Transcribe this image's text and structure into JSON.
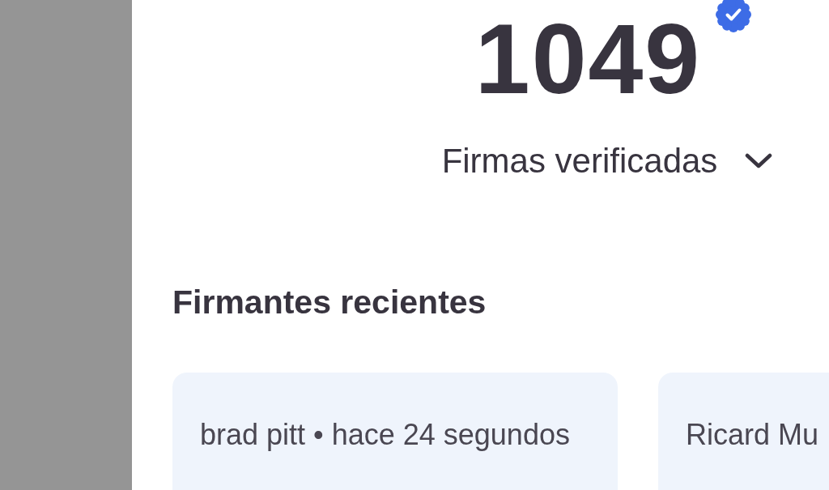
{
  "counter": {
    "value": "1049"
  },
  "filter": {
    "label": "Firmas verificadas",
    "expanded": false
  },
  "recent_signers": {
    "title": "Firmantes recientes",
    "items": [
      {
        "text": "brad pitt • hace 24 segundos"
      },
      {
        "text": "Ricard Mu"
      }
    ]
  }
}
